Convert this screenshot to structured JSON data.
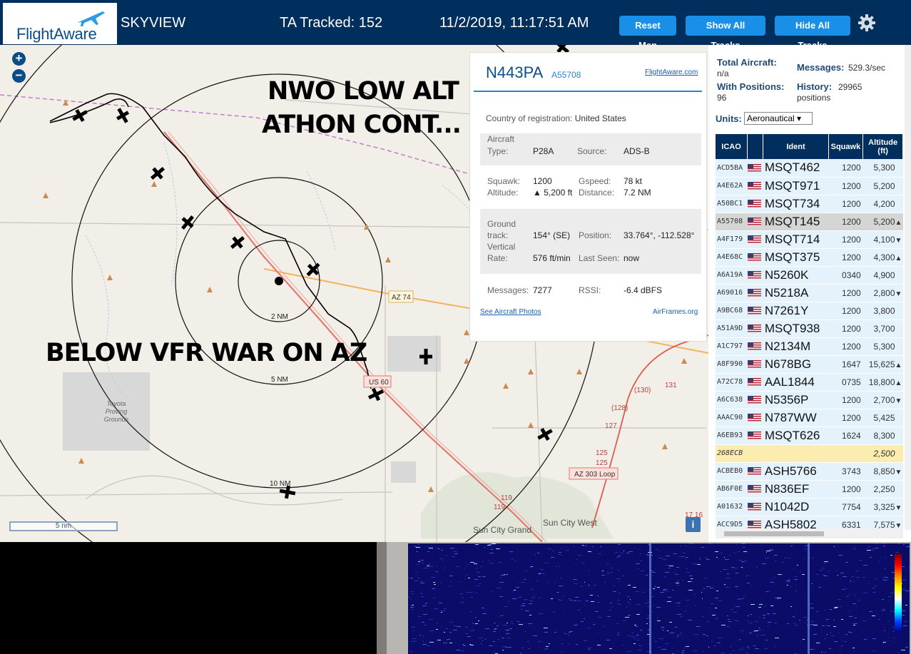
{
  "header": {
    "logo_text": "FlightAware",
    "site_name": "SKYVIEW",
    "tracked": "TA Tracked: 152",
    "datetime": "11/2/2019, 11:17:51 AM",
    "buttons": {
      "reset_map": "Reset Map",
      "show_all": "Show All Tracks",
      "hide_all": "Hide All Tracks"
    }
  },
  "map": {
    "zoom_in": "+",
    "zoom_out": "−",
    "overlay_lines": [
      "NWO LOW ALT",
      "ATHON CONT...",
      "BELOW VFR WAR ON AZ"
    ],
    "range_labels": [
      "2 NM",
      "5 NM",
      "10 NM"
    ],
    "road_labels": [
      "AZ 74",
      "US 60",
      "AZ 303 Loop",
      "(130)",
      "131",
      "(128)",
      "127",
      "125",
      "125",
      "119",
      "119",
      "17 16"
    ],
    "place_labels": [
      "Toyota Proving Grounds",
      "Sun City Grand",
      "Sun City West"
    ],
    "scale_label": "5 nm",
    "info_button": "i"
  },
  "popup": {
    "ident": "N443PA",
    "icao": "A55708",
    "link": "FlightAware.com",
    "country_label": "Country of registration:",
    "country": "United States",
    "aircraft_type_label": "Aircraft Type:",
    "aircraft_type_l1": "Aircraft",
    "aircraft_type_l2": "Type:",
    "aircraft_type": "P28A",
    "source_label": "Source:",
    "source": "ADS-B",
    "squawk_label": "Squawk:",
    "squawk": "1200",
    "gspeed_label": "Gspeed:",
    "gspeed": "78 kt",
    "altitude_label": "Altitude:",
    "altitude": "▲ 5,200 ft",
    "distance_label": "Distance:",
    "distance": "7.2 NM",
    "ground_l1": "Ground",
    "ground_l2": "track:",
    "ground_track": "154° (SE)",
    "position_label": "Position:",
    "position": "33.764°, -112.528°",
    "vr_l1": "Vertical",
    "vr_l2": "Rate:",
    "vertical_rate": "576 ft/min",
    "last_seen_label": "Last Seen:",
    "last_seen": "now",
    "messages_label": "Messages:",
    "messages": "7277",
    "rssi_label": "RSSI:",
    "rssi": "-6.4 dBFS",
    "photos_link": "See Aircraft Photos",
    "airframes_link": "AirFrames.org"
  },
  "panel": {
    "total_label": "Total Aircraft:",
    "total": "n/a",
    "messages_label": "Messages:",
    "messages": "529.3/sec",
    "positions_label": "With Positions:",
    "positions": "96",
    "history_label": "History:",
    "history": "29965",
    "history_unit": "positions",
    "units_label": "Units:",
    "units_value": "Aeronautical ▾",
    "columns": [
      "ICAO",
      "Ident",
      "Squawk",
      "Altitude (ft)"
    ],
    "rows": [
      {
        "icao": "ACD5BA",
        "ident": "MSQT462",
        "squawk": "1200",
        "alt": "5,300",
        "trend": "",
        "flag": true
      },
      {
        "icao": "A4E62A",
        "ident": "MSQT971",
        "squawk": "1200",
        "alt": "5,200",
        "trend": "",
        "flag": true
      },
      {
        "icao": "A50BC1",
        "ident": "MSQT734",
        "squawk": "1200",
        "alt": "4,200",
        "trend": "",
        "flag": true
      },
      {
        "icao": "A55708",
        "ident": "MSQT145",
        "squawk": "1200",
        "alt": "5,200",
        "trend": "▲",
        "flag": true,
        "selected": true
      },
      {
        "icao": "A4F179",
        "ident": "MSQT714",
        "squawk": "1200",
        "alt": "4,100",
        "trend": "▼",
        "flag": true
      },
      {
        "icao": "A4E68C",
        "ident": "MSQT375",
        "squawk": "1200",
        "alt": "4,300",
        "trend": "▲",
        "flag": true
      },
      {
        "icao": "A6A19A",
        "ident": "N5260K",
        "squawk": "0340",
        "alt": "4,900",
        "trend": "",
        "flag": true
      },
      {
        "icao": "A69016",
        "ident": "N5218A",
        "squawk": "1200",
        "alt": "2,800",
        "trend": "▼",
        "flag": true
      },
      {
        "icao": "A9BC68",
        "ident": "N7261Y",
        "squawk": "1200",
        "alt": "3,800",
        "trend": "",
        "flag": true
      },
      {
        "icao": "A51A9D",
        "ident": "MSQT938",
        "squawk": "1200",
        "alt": "3,700",
        "trend": "",
        "flag": true
      },
      {
        "icao": "A1C797",
        "ident": "N2134M",
        "squawk": "1200",
        "alt": "5,300",
        "trend": "",
        "flag": true
      },
      {
        "icao": "A8F990",
        "ident": "N678BG",
        "squawk": "1647",
        "alt": "15,625",
        "trend": "▲",
        "flag": true
      },
      {
        "icao": "A72C78",
        "ident": "AAL1844",
        "squawk": "0735",
        "alt": "18,800",
        "trend": "▲",
        "flag": true
      },
      {
        "icao": "A6C638",
        "ident": "N5356P",
        "squawk": "1200",
        "alt": "2,700",
        "trend": "▼",
        "flag": true
      },
      {
        "icao": "AAAC90",
        "ident": "N787WW",
        "squawk": "1200",
        "alt": "5,425",
        "trend": "",
        "flag": true
      },
      {
        "icao": "A6EB93",
        "ident": "MSQT626",
        "squawk": "1624",
        "alt": "8,300",
        "trend": "",
        "flag": true
      },
      {
        "icao": "268ECB",
        "ident": "",
        "squawk": "",
        "alt": "2,500",
        "trend": "",
        "flag": false,
        "noid": true
      },
      {
        "icao": "ACBEB0",
        "ident": "ASH5766",
        "squawk": "3743",
        "alt": "8,850",
        "trend": "▼",
        "flag": true
      },
      {
        "icao": "AB6F0E",
        "ident": "N836EF",
        "squawk": "1200",
        "alt": "2,250",
        "trend": "",
        "flag": true
      },
      {
        "icao": "A01632",
        "ident": "N1042D",
        "squawk": "7754",
        "alt": "3,325",
        "trend": "▼",
        "flag": true
      },
      {
        "icao": "ACC9D5",
        "ident": "ASH5802",
        "squawk": "6331",
        "alt": "7,575",
        "trend": "▼",
        "flag": true
      }
    ]
  },
  "colors": {
    "header_bg": "#002f5d",
    "button_bg": "#1a8fe8",
    "row_bg": "#e4f3fb",
    "waterfall_bg": "#0b0f6d"
  }
}
